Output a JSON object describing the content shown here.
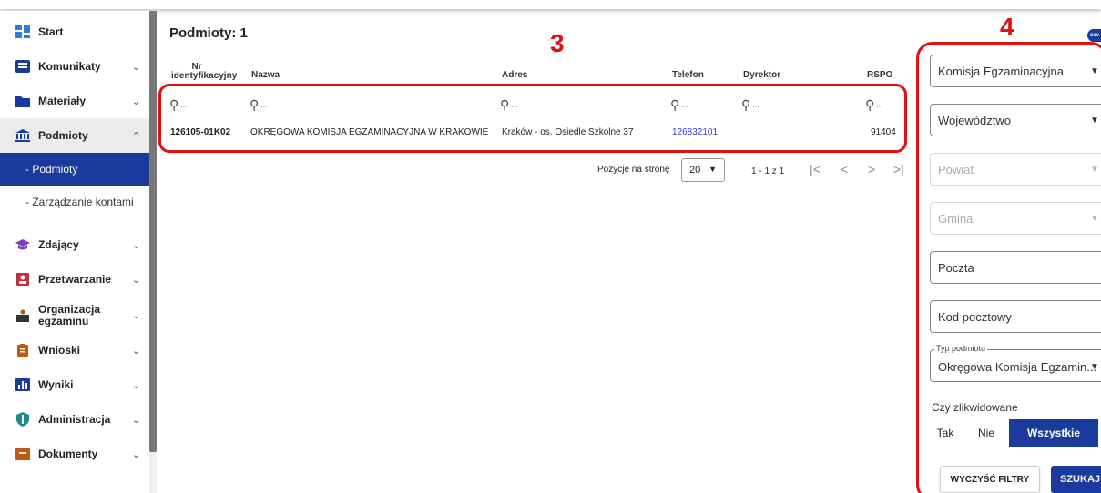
{
  "sidebar": {
    "items": [
      {
        "label": "Start",
        "icon": "dashboard-icon"
      },
      {
        "label": "Komunikaty",
        "icon": "message-icon"
      },
      {
        "label": "Materiały",
        "icon": "folder-icon"
      },
      {
        "label": "Podmioty",
        "icon": "institution-icon"
      },
      {
        "label": "Zdający",
        "icon": "graduation-cap-icon"
      },
      {
        "label": "Przetwarzanie",
        "icon": "contact-card-icon"
      },
      {
        "label": "Organizacja egzaminu",
        "icon": "exam-organization-icon"
      },
      {
        "label": "Wnioski",
        "icon": "clipboard-icon"
      },
      {
        "label": "Wyniki",
        "icon": "bar-chart-icon"
      },
      {
        "label": "Administracja",
        "icon": "shield-icon"
      },
      {
        "label": "Dokumenty",
        "icon": "documents-icon"
      }
    ],
    "subitems": [
      "- Podmioty",
      "- Zarządzanie kontami"
    ]
  },
  "main": {
    "title": "Podmioty: 1",
    "columns": [
      "Nr identyfikacyjny",
      "Nazwa",
      "Adres",
      "Telefon",
      "Dyrektor",
      "RSPO"
    ],
    "filter_placeholder": "...",
    "rows": [
      {
        "id": "126105-01K02",
        "name": "OKRĘGOWA KOMISJA EGZAMINACYJNA W KRAKOWIE",
        "address": "Kraków - os. Osiedle Szkolne 37",
        "phone": "126832101",
        "director": "",
        "rspo": "91404"
      }
    ],
    "pager": {
      "label": "Pozycje na stronę",
      "page_size": "20",
      "range": "1 - 1 z 1"
    }
  },
  "annotations": {
    "box3": "3",
    "box4": "4"
  },
  "filters": {
    "komisja": "Komisja Egzaminacyjna",
    "wojewodztwo": "Województwo",
    "powiat": "Powiat",
    "gmina": "Gmina",
    "poczta": "Poczta",
    "kod_pocztowy": "Kod pocztowy",
    "typ_label": "Typ podmiotu",
    "typ_value": "Okręgowa Komisja Egzamin...",
    "zlikwidowane_label": "Czy zlikwidowane",
    "zlikwidowane_options": [
      "Tak",
      "Nie",
      "Wszystkie"
    ],
    "zlikwidowane_selected": "Wszystkie",
    "clear_label": "WYCZYŚĆ FILTRY",
    "search_label": "SZUKAJ",
    "export_label": "csv"
  },
  "colors": {
    "accent": "#1a3a9c",
    "annotation_red": "#e01010",
    "link": "#3a3adf"
  }
}
